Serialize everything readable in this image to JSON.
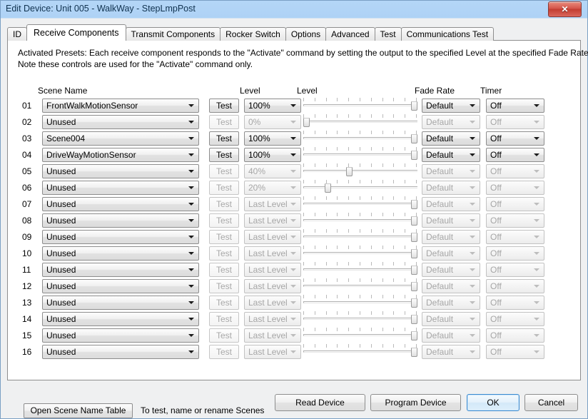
{
  "window": {
    "title": "Edit Device: Unit 005 - WalkWay - StepLmpPost",
    "close_label": "✕"
  },
  "tabs": [
    {
      "label": "ID",
      "active": false
    },
    {
      "label": "Receive Components",
      "active": true
    },
    {
      "label": "Transmit Components",
      "active": false
    },
    {
      "label": "Rocker Switch",
      "active": false
    },
    {
      "label": "Options",
      "active": false
    },
    {
      "label": "Advanced",
      "active": false
    },
    {
      "label": "Test",
      "active": false
    },
    {
      "label": "Communications Test",
      "active": false
    }
  ],
  "intro": {
    "line1": "Activated Presets: Each receive component responds to the \"Activate\" command by setting the output to the specified Level at the specified Fade Rate.",
    "line2": "Note these controls are used for the \"Activate\" command only."
  },
  "columns": {
    "scene_name": "Scene Name",
    "level_combo": "Level",
    "level_slider": "Level",
    "fade_rate": "Fade Rate",
    "timer": "Timer"
  },
  "test_button_label": "Test",
  "rows": [
    {
      "index": "01",
      "scene": "FrontWalkMotionSensor",
      "level": "100%",
      "slider_pct": 100,
      "fade": "Default",
      "timer": "Off",
      "enabled": true
    },
    {
      "index": "02",
      "scene": "Unused",
      "level": "0%",
      "slider_pct": 0,
      "fade": "Default",
      "timer": "Off",
      "enabled": false
    },
    {
      "index": "03",
      "scene": "Scene004",
      "level": "100%",
      "slider_pct": 100,
      "fade": "Default",
      "timer": "Off",
      "enabled": true
    },
    {
      "index": "04",
      "scene": "DriveWayMotionSensor",
      "level": "100%",
      "slider_pct": 100,
      "fade": "Default",
      "timer": "Off",
      "enabled": true
    },
    {
      "index": "05",
      "scene": "Unused",
      "level": "40%",
      "slider_pct": 40,
      "fade": "Default",
      "timer": "Off",
      "enabled": false
    },
    {
      "index": "06",
      "scene": "Unused",
      "level": "20%",
      "slider_pct": 20,
      "fade": "Default",
      "timer": "Off",
      "enabled": false
    },
    {
      "index": "07",
      "scene": "Unused",
      "level": "Last Level",
      "slider_pct": 100,
      "fade": "Default",
      "timer": "Off",
      "enabled": false
    },
    {
      "index": "08",
      "scene": "Unused",
      "level": "Last Level",
      "slider_pct": 100,
      "fade": "Default",
      "timer": "Off",
      "enabled": false
    },
    {
      "index": "09",
      "scene": "Unused",
      "level": "Last Level",
      "slider_pct": 100,
      "fade": "Default",
      "timer": "Off",
      "enabled": false
    },
    {
      "index": "10",
      "scene": "Unused",
      "level": "Last Level",
      "slider_pct": 100,
      "fade": "Default",
      "timer": "Off",
      "enabled": false
    },
    {
      "index": "11",
      "scene": "Unused",
      "level": "Last Level",
      "slider_pct": 100,
      "fade": "Default",
      "timer": "Off",
      "enabled": false
    },
    {
      "index": "12",
      "scene": "Unused",
      "level": "Last Level",
      "slider_pct": 100,
      "fade": "Default",
      "timer": "Off",
      "enabled": false
    },
    {
      "index": "13",
      "scene": "Unused",
      "level": "Last Level",
      "slider_pct": 100,
      "fade": "Default",
      "timer": "Off",
      "enabled": false
    },
    {
      "index": "14",
      "scene": "Unused",
      "level": "Last Level",
      "slider_pct": 100,
      "fade": "Default",
      "timer": "Off",
      "enabled": false
    },
    {
      "index": "15",
      "scene": "Unused",
      "level": "Last Level",
      "slider_pct": 100,
      "fade": "Default",
      "timer": "Off",
      "enabled": false
    },
    {
      "index": "16",
      "scene": "Unused",
      "level": "Last Level",
      "slider_pct": 100,
      "fade": "Default",
      "timer": "Off",
      "enabled": false
    }
  ],
  "panel_bottom": {
    "open_scene_table": "Open Scene Name Table",
    "hint": "To test, name or rename Scenes"
  },
  "footer": {
    "read_device": "Read Device",
    "program_device": "Program Device",
    "ok": "OK",
    "cancel": "Cancel"
  },
  "colors": {
    "titlebar": "#b0d4f5",
    "panel_bg": "#ffffff",
    "dialog_bg": "#eff0f1",
    "focus_accent": "#3b8bd0",
    "close_button": "#c33d32"
  }
}
